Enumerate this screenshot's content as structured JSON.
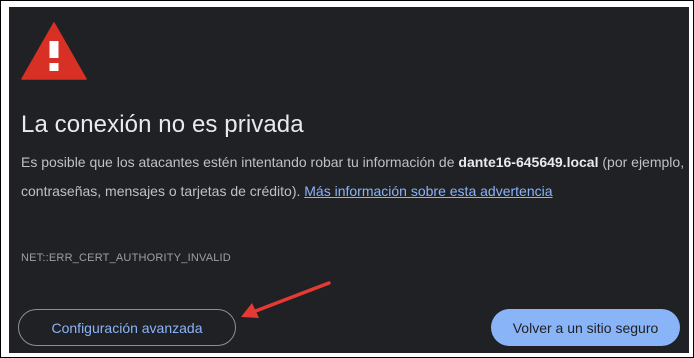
{
  "interstitial": {
    "title": "La conexión no es privada",
    "message_before": "Es posible que los atacantes estén intentando robar tu información de ",
    "host": "dante16-645649.local",
    "message_after": " (por ejemplo, contraseñas, mensajes o tarjetas de crédito). ",
    "learn_more_link": "Más información sobre esta advertencia",
    "error_code": "NET::ERR_CERT_AUTHORITY_INVALID",
    "advanced_button": "Configuración avanzada",
    "back_button": "Volver a un sitio seguro"
  },
  "icons": {
    "warning": "warning-triangle-icon",
    "annotation": "red-arrow-annotation"
  },
  "colors": {
    "background": "#202124",
    "warning_red": "#d93025",
    "link_blue": "#8ab4f8",
    "primary_button": "#8ab4f8",
    "annotation_red": "#e53935"
  }
}
